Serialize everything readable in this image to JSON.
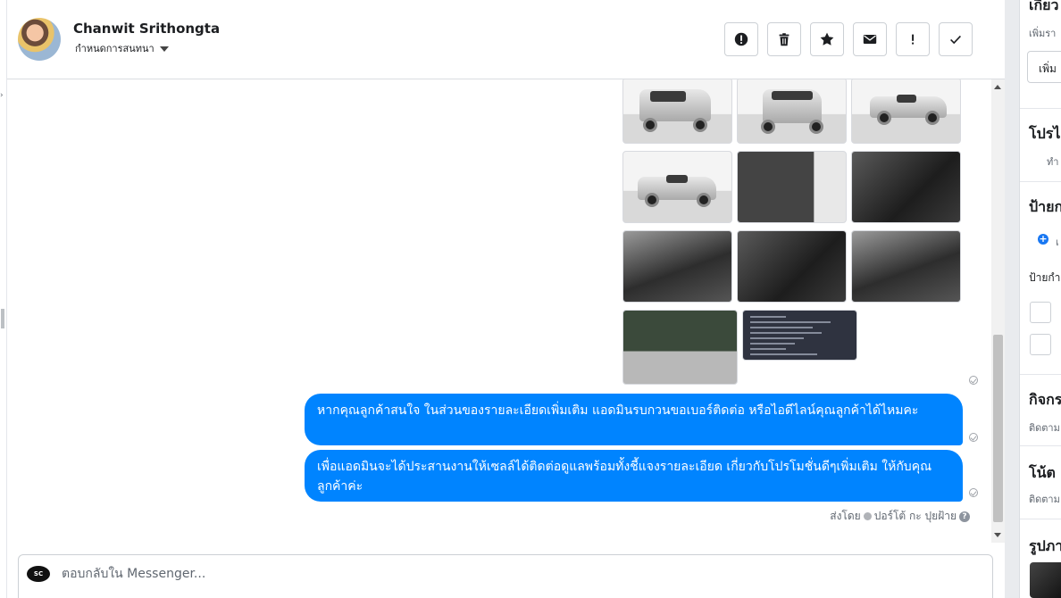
{
  "header": {
    "contact_name": "Chanwit Srithongta",
    "assign_label": "กำหนดการสนทนา"
  },
  "toolbar": {
    "buttons": [
      {
        "name": "spam-button",
        "icon": "exclamation-circle-icon"
      },
      {
        "name": "delete-button",
        "icon": "trash-icon"
      },
      {
        "name": "star-button",
        "icon": "star-icon"
      },
      {
        "name": "mark-unread-button",
        "icon": "envelope-icon"
      },
      {
        "name": "follow-up-button",
        "icon": "exclamation-icon"
      },
      {
        "name": "done-button",
        "icon": "check-icon"
      }
    ]
  },
  "messages": [
    {
      "text": "หากคุณลูกค้าสนใจ ในส่วนของรายละเอียดเพิ่มเติม แอดมินรบกวนขอเบอร์ติดต่อ หรือไอดีไลน์คุณลูกค้าได้ไหมคะ"
    },
    {
      "text": "เพื่อแอดมินจะได้ประสานงานให้เซลล์ได้ติดต่อดูแลพร้อมทั้งชี้แจงรายละเอียด เกี่ยวกับโปรโมชั่นดีๆเพิ่มเติม ให้กับคุณลูกค้าค่ะ"
    }
  ],
  "sent_by": {
    "prefix": "ส่งโดย",
    "name": "ปอร์โต้ กะ ปุยฝ้าย",
    "help": "?"
  },
  "composer": {
    "logo_text": "SC",
    "placeholder": "ตอบกลับใน Messenger..."
  },
  "right_panel": {
    "about_title": "เกี่ยว",
    "about_sub": "เพิ่มรา",
    "about_button": "เพิ่ม",
    "profile_title": "โปรไ",
    "profile_sub": "ทำ",
    "labels_title": "ป้ายก",
    "labels_add": "เ",
    "labels_sub": "ป้ายกำ",
    "activity_title": "กิจกร",
    "activity_sub": "ติดตาม",
    "notes_title": "โน้ต",
    "notes_sub": "ติดตาม",
    "photos_title": "รูปภา"
  },
  "colors": {
    "bubble": "#0084ff",
    "accent": "#1877f2"
  }
}
